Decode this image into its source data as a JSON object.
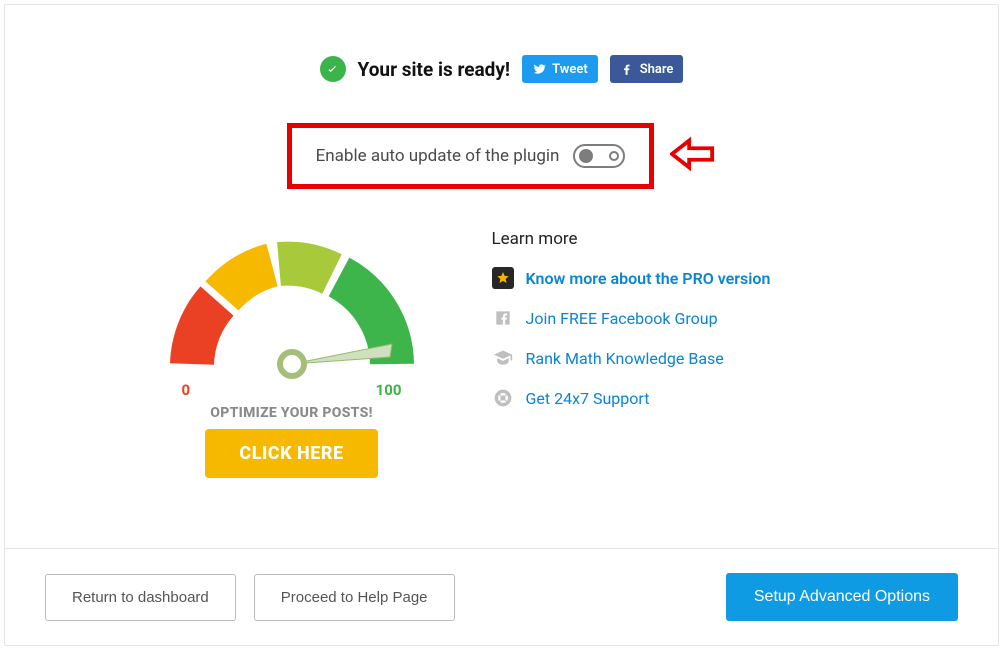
{
  "header": {
    "ready_text": "Your site is ready!",
    "tweet_label": "Tweet",
    "share_label": "Share"
  },
  "auto_update": {
    "label": "Enable auto update of the plugin",
    "enabled": false
  },
  "gauge": {
    "min_label": "0",
    "max_label": "100",
    "caption": "OPTIMIZE YOUR POSTS!",
    "cta": "CLICK HERE"
  },
  "learn": {
    "title": "Learn more",
    "items": [
      {
        "label": "Know more about the PRO version",
        "icon": "star-icon",
        "emphasis": true
      },
      {
        "label": "Join FREE Facebook Group",
        "icon": "facebook-f-icon"
      },
      {
        "label": "Rank Math Knowledge Base",
        "icon": "graduation-cap-icon"
      },
      {
        "label": "Get 24x7 Support",
        "icon": "life-ring-icon"
      }
    ]
  },
  "footer": {
    "return_label": "Return to dashboard",
    "help_label": "Proceed to Help Page",
    "advanced_label": "Setup Advanced Options"
  },
  "colors": {
    "highlight": "#e80000",
    "primary": "#0e9be4",
    "cta": "#f6b900",
    "success": "#3bb54a"
  }
}
